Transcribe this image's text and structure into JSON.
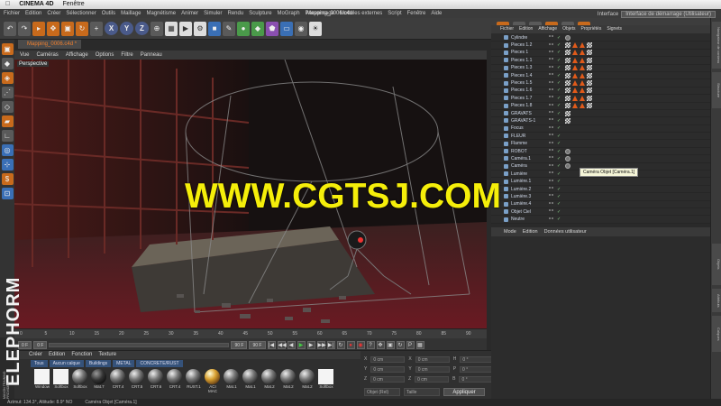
{
  "mac_menu": {
    "app": "CINEMA 4D",
    "item": "Fenêtre"
  },
  "menu": [
    "Fichier",
    "Edition",
    "Créer",
    "Sélectionner",
    "Outils",
    "Maillage",
    "Magnétisme",
    "Animer",
    "Simuler",
    "Rendu",
    "Sculpture",
    "MoGraph",
    "Personnage",
    "Modules externes",
    "Script",
    "Fenêtre",
    "Aide"
  ],
  "document_title": "Mapping_0006.c4d",
  "layout": {
    "label": "Interface",
    "value": "Interface de démarrage (Utilisateur)"
  },
  "toolbar_axes": [
    "X",
    "Y",
    "Z"
  ],
  "viewport": {
    "tab": "Mapping_0006.c4d *",
    "menu": [
      "Vue",
      "Caméras",
      "Affichage",
      "Options",
      "Filtre",
      "Panneau"
    ],
    "label": "Perspective"
  },
  "timeline": {
    "ticks": [
      "0",
      "5",
      "10",
      "15",
      "20",
      "25",
      "30",
      "35",
      "40",
      "45",
      "50",
      "55",
      "60",
      "65",
      "70",
      "75",
      "80",
      "85",
      "90"
    ],
    "start_frame": "0 F",
    "end_frame": "90 F",
    "current_frame": "0 F",
    "frame_field": "0 F",
    "end_field": "90 F"
  },
  "material_manager": {
    "menu": [
      "Créer",
      "Edition",
      "Fonction",
      "Texture"
    ],
    "tabs": [
      "Tous",
      "Aucun calque",
      "Buildings",
      "METAL",
      "CONCRETE/RUST"
    ],
    "materials": [
      {
        "name": "Window",
        "kind": "white"
      },
      {
        "name": "Softbox",
        "kind": "white"
      },
      {
        "name": "Softbox",
        "kind": "ball"
      },
      {
        "name": "Mat.7",
        "kind": "dark"
      },
      {
        "name": "CRT.4",
        "kind": "ball"
      },
      {
        "name": "CRT.5",
        "kind": "ball"
      },
      {
        "name": "CRT.6",
        "kind": "ball"
      },
      {
        "name": "CRT.4",
        "kind": "ball"
      },
      {
        "name": "RUST.1",
        "kind": "ball"
      },
      {
        "name": "ACI MAC",
        "kind": "orange"
      },
      {
        "name": "Mat.1",
        "kind": "ball"
      },
      {
        "name": "Mat.1",
        "kind": "ball"
      },
      {
        "name": "Mat.2",
        "kind": "ball"
      },
      {
        "name": "Mat.2",
        "kind": "ball"
      },
      {
        "name": "Mat.2",
        "kind": "ball"
      },
      {
        "name": "Softbox",
        "kind": "white"
      }
    ]
  },
  "coordinates": {
    "rows": [
      [
        "X",
        "0 cm",
        "X",
        "0 cm",
        "H",
        "0 °"
      ],
      [
        "Y",
        "0 cm",
        "Y",
        "0 cm",
        "P",
        "0 °"
      ],
      [
        "Z",
        "0 cm",
        "Z",
        "0 cm",
        "B",
        "0 °"
      ]
    ],
    "mode1": "Objet (Rel)",
    "mode2": "Taille",
    "apply": "Appliquer"
  },
  "object_manager": {
    "menu": [
      "Fichier",
      "Edition",
      "Affichage",
      "Objets",
      "Propriétés",
      "Signets"
    ],
    "objects": [
      {
        "name": "Cylindre",
        "tags": "circ"
      },
      {
        "name": "Pieces 1.2",
        "tags": "full"
      },
      {
        "name": "Pieces 1",
        "tags": "full"
      },
      {
        "name": "Pieces 1.1",
        "tags": "full"
      },
      {
        "name": "Pieces 1.3",
        "tags": "full"
      },
      {
        "name": "Pieces 1.4",
        "tags": "full"
      },
      {
        "name": "Pieces 1.5",
        "tags": "full"
      },
      {
        "name": "Pieces 1.6",
        "tags": "full"
      },
      {
        "name": "Pieces 1.7",
        "tags": "full"
      },
      {
        "name": "Pieces 1.8",
        "tags": "full"
      },
      {
        "name": "GRAVATS",
        "tags": "checker"
      },
      {
        "name": "GRAVATS-1",
        "tags": "checker"
      },
      {
        "name": "Focus",
        "tags": ""
      },
      {
        "name": "FLEUR",
        "tags": ""
      },
      {
        "name": "Flamme",
        "tags": ""
      },
      {
        "name": "ROBOT",
        "tags": "circ"
      },
      {
        "name": "Caméra.1",
        "tags": "circ"
      },
      {
        "name": "Caméra",
        "tags": "circ"
      },
      {
        "name": "Lumière",
        "tags": ""
      },
      {
        "name": "Lumière.1",
        "tags": ""
      },
      {
        "name": "Lumière.2",
        "tags": ""
      },
      {
        "name": "Lumière.3",
        "tags": ""
      },
      {
        "name": "Lumière.4",
        "tags": ""
      },
      {
        "name": "Objet Ciel",
        "tags": ""
      },
      {
        "name": "Neutre",
        "tags": ""
      }
    ],
    "tooltip": "Caméra Objet [Caméra.1]"
  },
  "attributes": {
    "menu": [
      "Mode",
      "Edition",
      "Données utilisateur"
    ]
  },
  "side_tabs": [
    "Navigateur de contenu",
    "Structure",
    "Objets",
    "Attributs",
    "Calques"
  ],
  "status": {
    "coords": "Azimut: 134.3°, Altitude: 8.9°  NO",
    "object": "Caméra Objet [Caméra.1]"
  },
  "watermark": "WWW.CGTSJ.COM",
  "brand": "ELEPHORM",
  "brand_sub": "MAXON TRAINING PROVIDER"
}
